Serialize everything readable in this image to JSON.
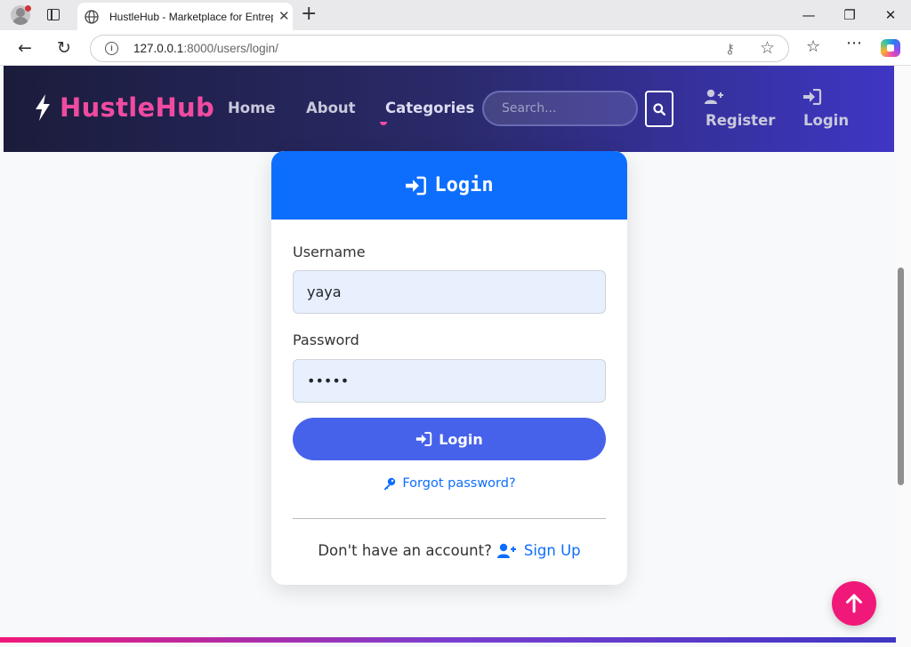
{
  "browser": {
    "tab_title": "HustleHub - Marketplace for Entrepreneurs",
    "url_host": "127.0.0.1",
    "url_rest": ":8000/users/login/",
    "new_tab_label": "+",
    "min_label": "—",
    "max_label": "❐",
    "close_label": "✕"
  },
  "navbar": {
    "brand": "HustleHub",
    "links": [
      "Home",
      "About",
      "Categories"
    ],
    "search_placeholder": "Search...",
    "register_label": "Register",
    "login_label": "Login"
  },
  "login_card": {
    "title": "Login",
    "username_label": "Username",
    "username_value": "yaya",
    "password_label": "Password",
    "password_value": "•••••",
    "submit_label": "Login",
    "forgot_label": "Forgot password?",
    "no_account_text": "Don't have an account?",
    "signup_label": "Sign Up"
  },
  "colors": {
    "brand": "#f04ba0",
    "primary": "#0d6efd",
    "login_button": "#4762ea",
    "scroll_top": "#f0197a"
  },
  "icons": [
    "bolt-icon",
    "search-icon",
    "user-plus-icon",
    "sign-in-icon",
    "key-icon",
    "arrow-up-icon"
  ]
}
